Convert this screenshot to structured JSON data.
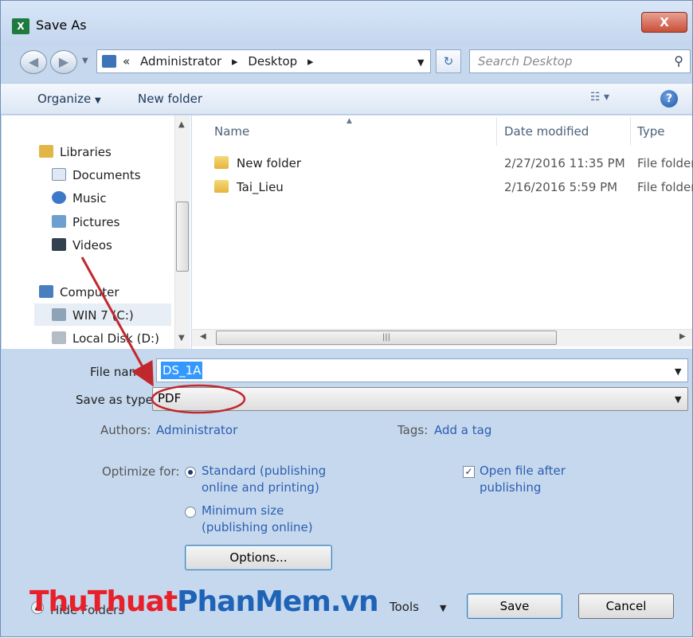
{
  "window": {
    "title": "Save As",
    "close_label": "X"
  },
  "address": {
    "overflow": "«",
    "segments": [
      "Administrator",
      "Desktop"
    ],
    "search_placeholder": "Search Desktop"
  },
  "toolbar": {
    "organize": "Organize",
    "new_folder": "New folder"
  },
  "nav": {
    "items": [
      {
        "label": "Libraries",
        "icon": "libraries-icon"
      },
      {
        "label": "Documents",
        "icon": "documents-icon"
      },
      {
        "label": "Music",
        "icon": "music-icon"
      },
      {
        "label": "Pictures",
        "icon": "pictures-icon"
      },
      {
        "label": "Videos",
        "icon": "videos-icon"
      },
      {
        "label": "Computer",
        "icon": "computer-icon"
      },
      {
        "label": "WIN 7 (C:)",
        "icon": "drive-icon"
      },
      {
        "label": "Local Disk (D:)",
        "icon": "disk-icon"
      }
    ]
  },
  "files": {
    "columns": [
      "Name",
      "Date modified",
      "Type"
    ],
    "rows": [
      {
        "name": "New folder",
        "date": "2/27/2016 11:35 PM",
        "type": "File folder"
      },
      {
        "name": "Tai_Lieu",
        "date": "2/16/2016 5:59 PM",
        "type": "File folder"
      }
    ]
  },
  "form": {
    "file_name_label": "File name:",
    "file_name_value": "DS_1A",
    "save_as_type_label": "Save as type:",
    "save_as_type_value": "PDF",
    "authors_label": "Authors:",
    "authors_value": "Administrator",
    "tags_label": "Tags:",
    "tags_value": "Add a tag",
    "optimize_label": "Optimize for:",
    "optimize_standard": [
      "Standard (publishing",
      "online and printing)"
    ],
    "optimize_minimum": [
      "Minimum size",
      "(publishing online)"
    ],
    "open_after": [
      "Open file after",
      "publishing"
    ],
    "options_button": "Options..."
  },
  "footer": {
    "hide_folders": "Hide Folders",
    "tools": "Tools",
    "save": "Save",
    "cancel": "Cancel"
  },
  "watermark": {
    "part1": "ThuThuat",
    "part2": "PhanMem.vn"
  },
  "colors": {
    "link": "#2a5fb0",
    "selection": "#3399ff",
    "annotation": "#c0282d"
  }
}
